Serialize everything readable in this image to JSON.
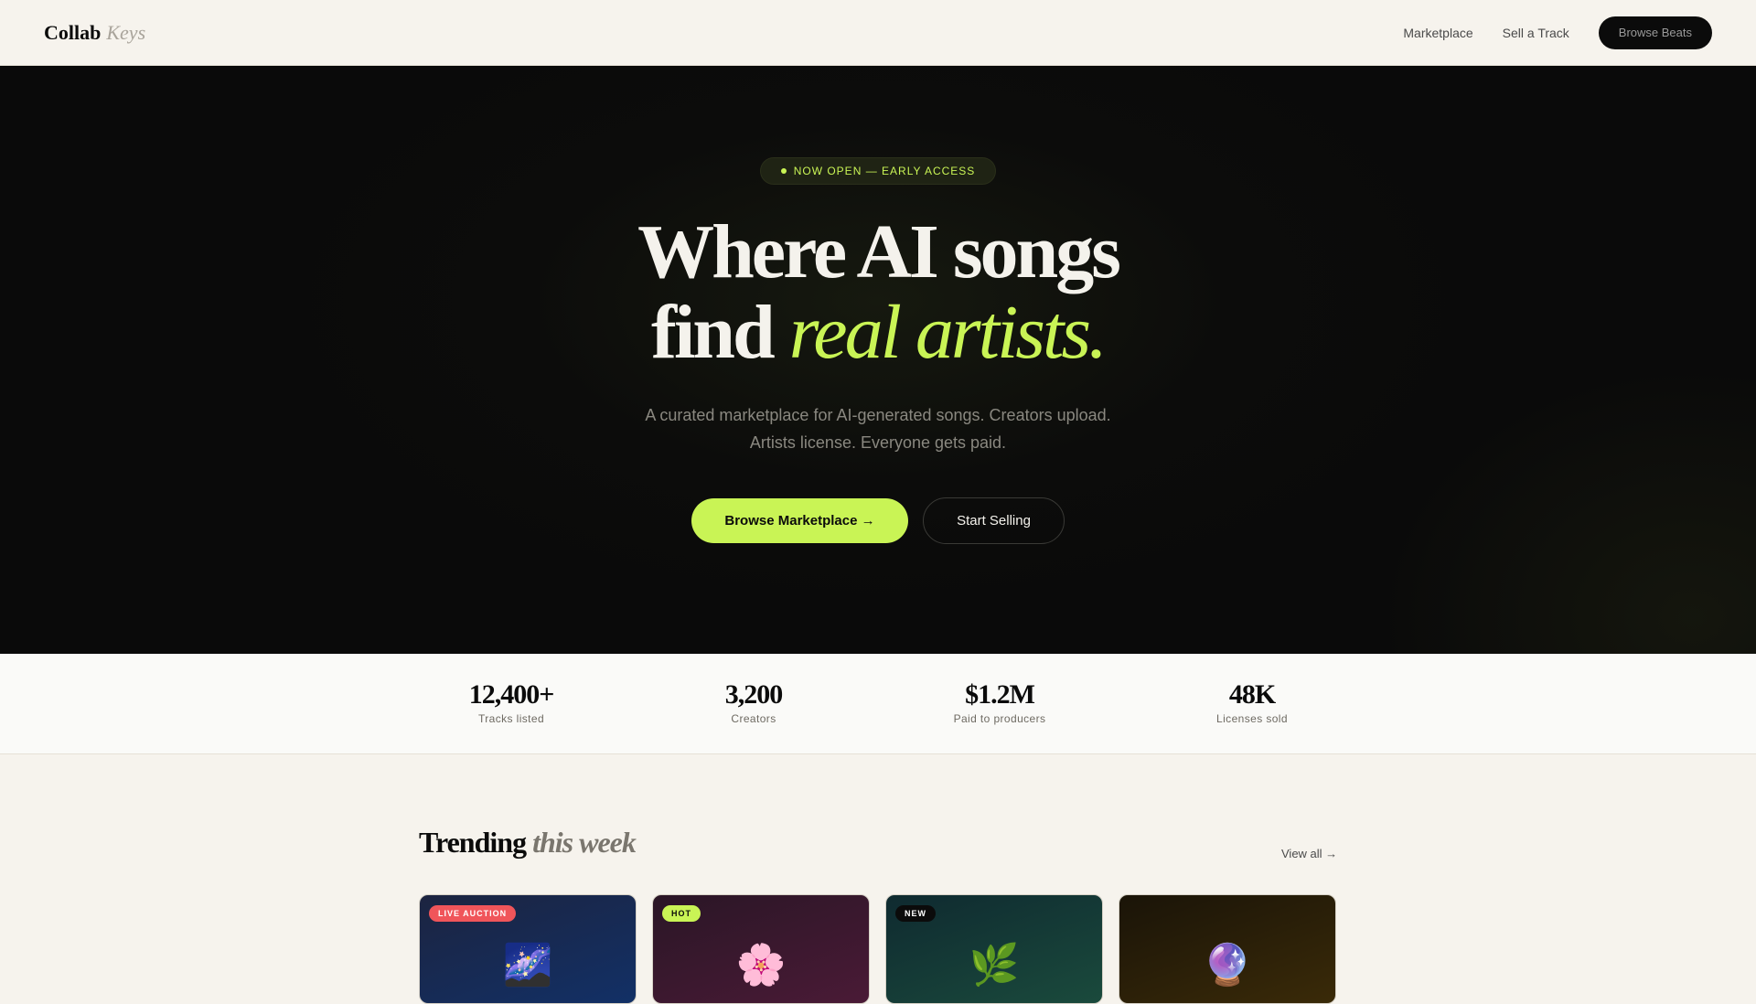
{
  "nav": {
    "logo_main": "Collab",
    "logo_sub": "Keys",
    "links": [
      "Marketplace",
      "Sell a Track"
    ],
    "cta": "Browse Beats"
  },
  "hero": {
    "pill_text": "NOW OPEN — EARLY ACCESS",
    "title_line1": "Where AI songs",
    "title_line2_plain": "find",
    "title_line2_accent": "real artists.",
    "subtitle_line1": "A curated marketplace for AI-generated songs. Creators upload.",
    "subtitle_line2": "Artists license. Everyone gets paid.",
    "primary_button": "Browse Marketplace →",
    "secondary_button": "Start Selling"
  },
  "stats": [
    {
      "value": "12,400+",
      "label": "Tracks listed"
    },
    {
      "value": "3,200",
      "label": "Creators"
    },
    {
      "value": "$1.2M",
      "label": "Paid to producers"
    },
    {
      "value": "48K",
      "label": "Licenses sold"
    }
  ],
  "trending": {
    "title_main": "Trending",
    "title_sub": "this week",
    "view_all": "View all →",
    "cards": [
      {
        "badge": "LIVE AUCTION",
        "icon": "🌌",
        "icon_name": "galaxy-icon"
      },
      {
        "badge": "HOT",
        "icon": "🌸",
        "icon_name": "cherry-blossom-icon"
      },
      {
        "badge": "NEW",
        "icon": "🌿",
        "icon_name": "herb-icon"
      },
      {
        "badge": "",
        "icon": "🔮",
        "icon_name": "crystal-ball-icon"
      }
    ]
  },
  "colors": {
    "accent": "#c9f455",
    "dark": "#0b0b0b",
    "cream": "#f6f3ed",
    "live_badge": "#f0555a"
  }
}
